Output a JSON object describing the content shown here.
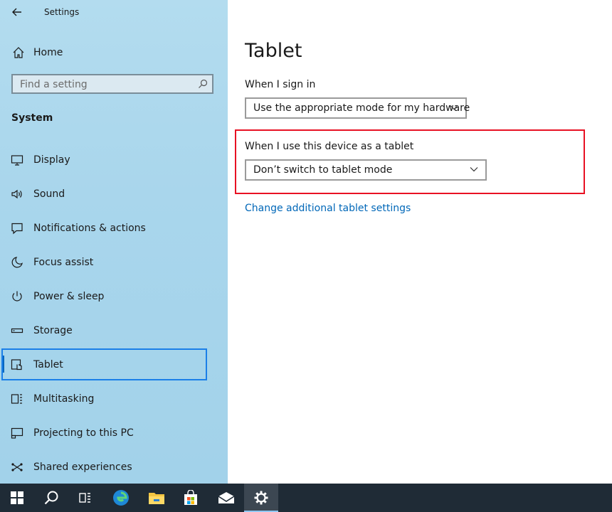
{
  "window": {
    "title": "Settings"
  },
  "sidebar": {
    "home_label": "Home",
    "search_placeholder": "Find a setting",
    "section_title": "System",
    "items": [
      {
        "label": "Display",
        "icon": "display-icon"
      },
      {
        "label": "Sound",
        "icon": "speaker-icon"
      },
      {
        "label": "Notifications & actions",
        "icon": "notification-icon"
      },
      {
        "label": "Focus assist",
        "icon": "moon-icon"
      },
      {
        "label": "Power & sleep",
        "icon": "power-icon"
      },
      {
        "label": "Storage",
        "icon": "storage-icon"
      },
      {
        "label": "Tablet",
        "icon": "tablet-icon",
        "selected": true
      },
      {
        "label": "Multitasking",
        "icon": "multitasking-icon"
      },
      {
        "label": "Projecting to this PC",
        "icon": "projecting-icon"
      },
      {
        "label": "Shared experiences",
        "icon": "shared-icon"
      }
    ]
  },
  "main": {
    "page_title": "Tablet",
    "sign_in_label": "When I sign in",
    "sign_in_value": "Use the appropriate mode for my hardware",
    "tablet_label": "When I use this device as a tablet",
    "tablet_value": "Don’t switch to tablet mode",
    "link": "Change additional tablet settings"
  },
  "colors": {
    "sidebar_bg": "#a9d6ec",
    "accent": "#0067b8",
    "highlight_red": "#e81123",
    "selection_blue": "#1b7fe8",
    "taskbar": "#1f2b36"
  },
  "taskbar": {
    "buttons": [
      "windows-start-icon",
      "search-icon",
      "task-view-icon",
      "edge-icon",
      "file-explorer-icon",
      "store-icon",
      "mail-icon",
      "settings-gear-icon"
    ]
  }
}
